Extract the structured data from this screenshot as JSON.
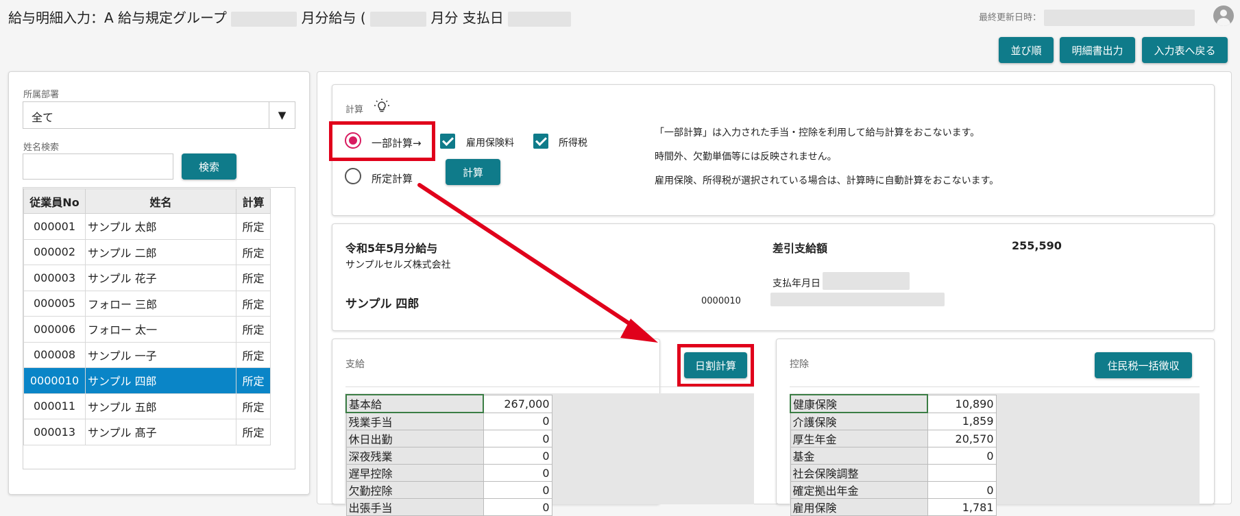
{
  "header": {
    "title": "給与明細入力：A 給与規定グループ",
    "title_mid1": "月分給与 (",
    "title_mid2": "月分 支払日",
    "last_updated_label": "最終更新日時：",
    "buttons": {
      "sort": "並び順",
      "print": "明細書出力",
      "back": "入力表へ戻る"
    }
  },
  "sidebar": {
    "department_label": "所属部署",
    "department_value": "全て",
    "dropdown_arrow": "▼",
    "name_search_label": "姓名検索",
    "name_search_value": "",
    "search_button": "検索",
    "columns": [
      "従業員No",
      "姓名",
      "計算"
    ],
    "employees": [
      {
        "no": "000001",
        "name": "サンプル 太郎",
        "calc": "所定"
      },
      {
        "no": "000002",
        "name": "サンプル 二郎",
        "calc": "所定"
      },
      {
        "no": "000003",
        "name": "サンプル 花子",
        "calc": "所定"
      },
      {
        "no": "000005",
        "name": "フォロー 三郎",
        "calc": "所定"
      },
      {
        "no": "000006",
        "name": "フォロー 太一",
        "calc": "所定"
      },
      {
        "no": "000008",
        "name": "サンプル 一子",
        "calc": "所定"
      },
      {
        "no": "0000010",
        "name": "サンプル 四郎",
        "calc": "所定",
        "selected": true
      },
      {
        "no": "000011",
        "name": "サンプル 五郎",
        "calc": "所定"
      },
      {
        "no": "000013",
        "name": "サンプル 髙子",
        "calc": "所定"
      }
    ]
  },
  "calc": {
    "label": "計算",
    "partial": "一部計算→",
    "standard": "所定計算",
    "employment_insurance": "雇用保険料",
    "income_tax": "所得税",
    "calc_button": "計算",
    "notes": [
      "「一部計算」は入力された手当・控除を利用して給与計算をおこないます。",
      "時間外、欠勤単価等には反映されません。",
      "雇用保険、所得税が選択されている場合は、計算時に自動計算をおこないます。"
    ]
  },
  "summary": {
    "pay_title": "令和5年5月分給与",
    "company": "サンプルセルズ株式会社",
    "employee_name": "サンプル 四郎",
    "employee_no": "0000010",
    "net_pay_label": "差引支給額",
    "net_pay_value": "255,590",
    "pay_date_label": "支払年月日"
  },
  "payments": {
    "label": "支給",
    "prorate_button": "日割計算",
    "rows": [
      {
        "k": "基本給",
        "v": "267,000"
      },
      {
        "k": "残業手当",
        "v": "0"
      },
      {
        "k": "休日出勤",
        "v": "0"
      },
      {
        "k": "深夜残業",
        "v": "0"
      },
      {
        "k": "遅早控除",
        "v": "0"
      },
      {
        "k": "欠勤控除",
        "v": "0"
      },
      {
        "k": "出張手当",
        "v": "0"
      }
    ]
  },
  "deductions": {
    "label": "控除",
    "resident_tax_button": "住民税一括徴収",
    "rows": [
      {
        "k": "健康保険",
        "v": "10,890"
      },
      {
        "k": "介護保険",
        "v": "1,859"
      },
      {
        "k": "厚生年金",
        "v": "20,570"
      },
      {
        "k": "基金",
        "v": "0"
      },
      {
        "k": "社会保険調整",
        "v": ""
      },
      {
        "k": "確定拠出年金",
        "v": "0"
      },
      {
        "k": "雇用保険",
        "v": "1,781"
      }
    ]
  },
  "colors": {
    "accent": "#0f7b8a",
    "highlight": "#e0001b",
    "selected_row": "#0a85c7",
    "radio": "#d81b60"
  }
}
